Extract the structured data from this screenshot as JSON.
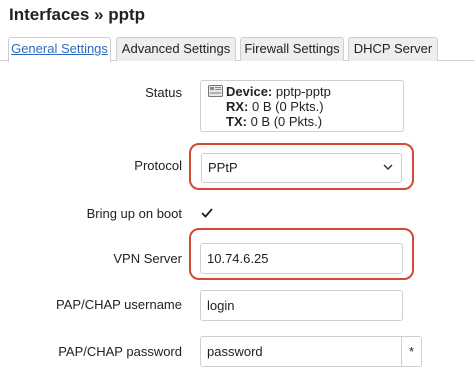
{
  "page": {
    "title": "Interfaces » pptp"
  },
  "tabs": [
    {
      "label": "General Settings",
      "active": true
    },
    {
      "label": "Advanced Settings",
      "active": false
    },
    {
      "label": "Firewall Settings",
      "active": false
    },
    {
      "label": "DHCP Server",
      "active": false
    }
  ],
  "status": {
    "label": "Status",
    "device_key": "Device:",
    "device_value": "pptp-pptp",
    "rx_key": "RX:",
    "rx_value": "0 B (0 Pkts.)",
    "tx_key": "TX:",
    "tx_value": "0 B (0 Pkts.)",
    "icon": "network-interface-icon"
  },
  "protocol": {
    "label": "Protocol",
    "value": "PPtP"
  },
  "boot": {
    "label": "Bring up on boot",
    "checked": true
  },
  "vpn_server": {
    "label": "VPN Server",
    "value": "10.74.6.25"
  },
  "username": {
    "label": "PAP/CHAP username",
    "value": "login"
  },
  "password": {
    "label": "PAP/CHAP password",
    "value": "password",
    "reveal_label": "*"
  },
  "colors": {
    "highlight": "#d24a32",
    "active_tab_text": "#2a6bbf"
  }
}
